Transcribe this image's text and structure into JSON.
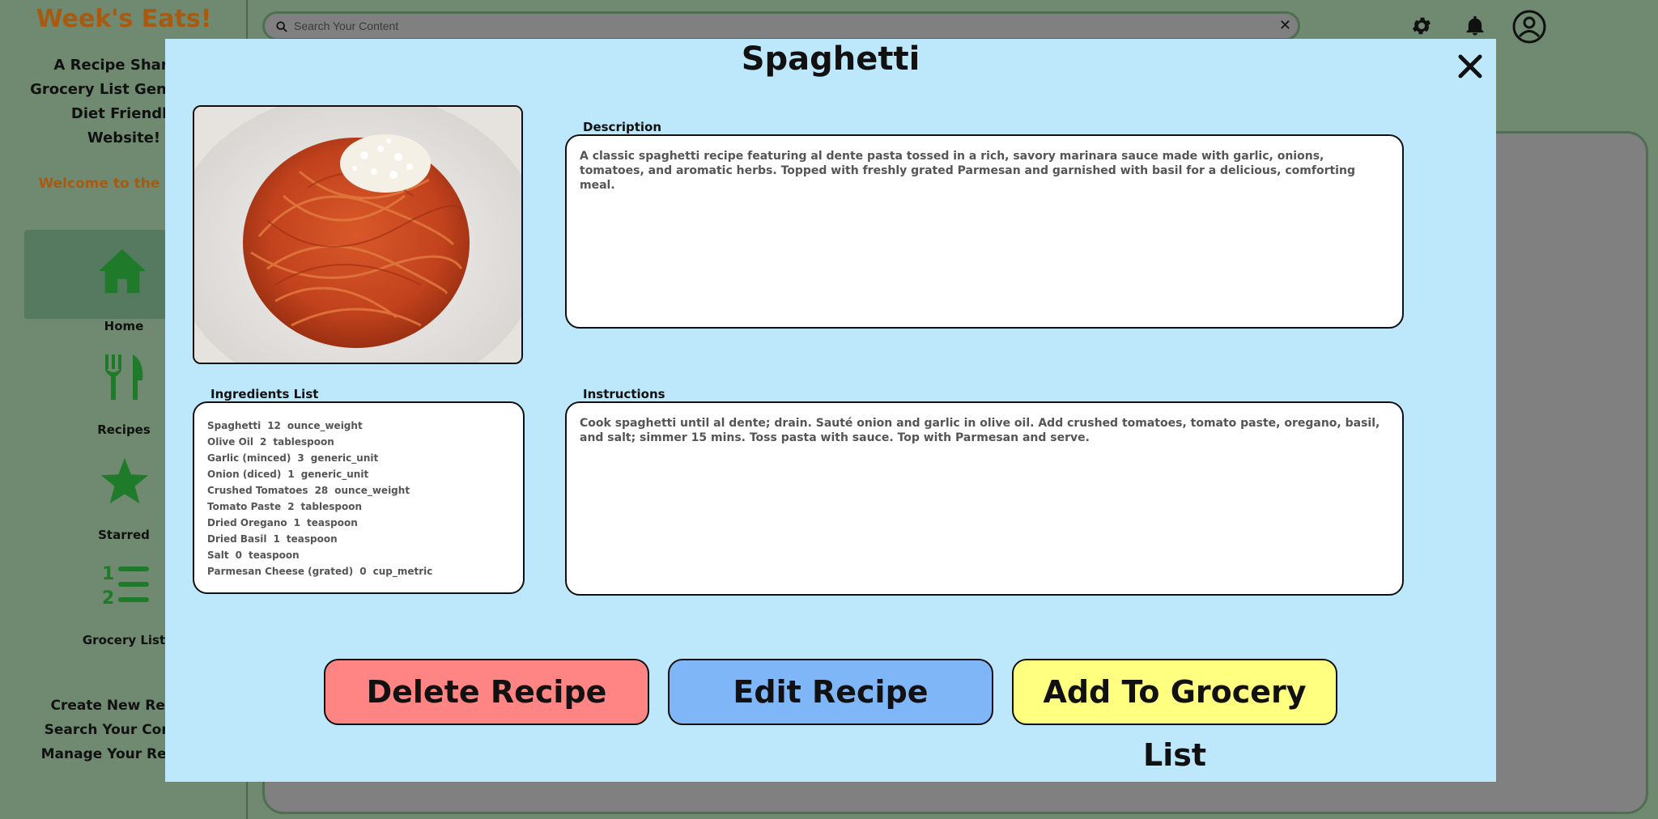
{
  "app": {
    "brand": "Week's Eats!",
    "tagline": [
      "A Recipe Sharing",
      "Grocery List Generator",
      "Diet Friendly",
      "Website!"
    ],
    "welcome": "Welcome to the Home",
    "nav": [
      {
        "label": "Home",
        "icon": "home-icon",
        "active": true
      },
      {
        "label": "Recipes",
        "icon": "fork-knife-icon",
        "active": false
      },
      {
        "label": "Starred",
        "icon": "star-icon",
        "active": false
      },
      {
        "label": "Grocery List",
        "icon": "numbered-list-icon",
        "active": false
      }
    ],
    "links": [
      "Create New Recipe",
      "Search Your Content",
      "Manage Your Recipes"
    ]
  },
  "search": {
    "placeholder": "Search Your Content",
    "clear_label": "✕"
  },
  "topbar": {
    "icons": [
      "gear-icon",
      "bell-icon",
      "account-icon"
    ]
  },
  "modal": {
    "title": "Spaghetti",
    "close_label": "✕",
    "description_label": "Description",
    "description": "A classic spaghetti recipe featuring al dente pasta tossed in a rich, savory marinara sauce made with garlic, onions, tomatoes, and aromatic herbs. Topped with freshly grated Parmesan and garnished with basil for a delicious, comforting meal.",
    "ingredients_label": "Ingredients List",
    "ingredients": [
      {
        "name": "Spaghetti",
        "qty": "12",
        "unit": "ounce_weight"
      },
      {
        "name": "Olive Oil",
        "qty": "2",
        "unit": "tablespoon"
      },
      {
        "name": "Garlic (minced)",
        "qty": "3",
        "unit": "generic_unit"
      },
      {
        "name": "Onion (diced)",
        "qty": "1",
        "unit": "generic_unit"
      },
      {
        "name": "Crushed Tomatoes",
        "qty": "28",
        "unit": "ounce_weight"
      },
      {
        "name": "Tomato Paste",
        "qty": "2",
        "unit": "tablespoon"
      },
      {
        "name": "Dried Oregano",
        "qty": "1",
        "unit": "teaspoon"
      },
      {
        "name": "Dried Basil",
        "qty": "1",
        "unit": "teaspoon"
      },
      {
        "name": "Salt",
        "qty": "0",
        "unit": "teaspoon"
      },
      {
        "name": "Parmesan Cheese (grated)",
        "qty": "0",
        "unit": "cup_metric"
      }
    ],
    "instructions_label": "Instructions",
    "instructions": "Cook spaghetti until al dente; drain. Sauté onion and garlic in olive oil. Add crushed tomatoes, tomato paste, oregano, basil, and salt; simmer 15 mins. Toss pasta with sauce. Top with Parmesan and serve.",
    "buttons": {
      "delete": "Delete Recipe",
      "edit": "Edit Recipe",
      "add_grocery": "Add To Grocery List"
    }
  },
  "colors": {
    "overlay_green": "#6f8a70",
    "modal_bg": "#bde7fb",
    "brand_orange": "#a85a10",
    "nav_green": "#1f7a2a",
    "delete_red": "#ff8585",
    "edit_blue": "#7fb6f7",
    "grocery_yellow": "#ffff80"
  }
}
